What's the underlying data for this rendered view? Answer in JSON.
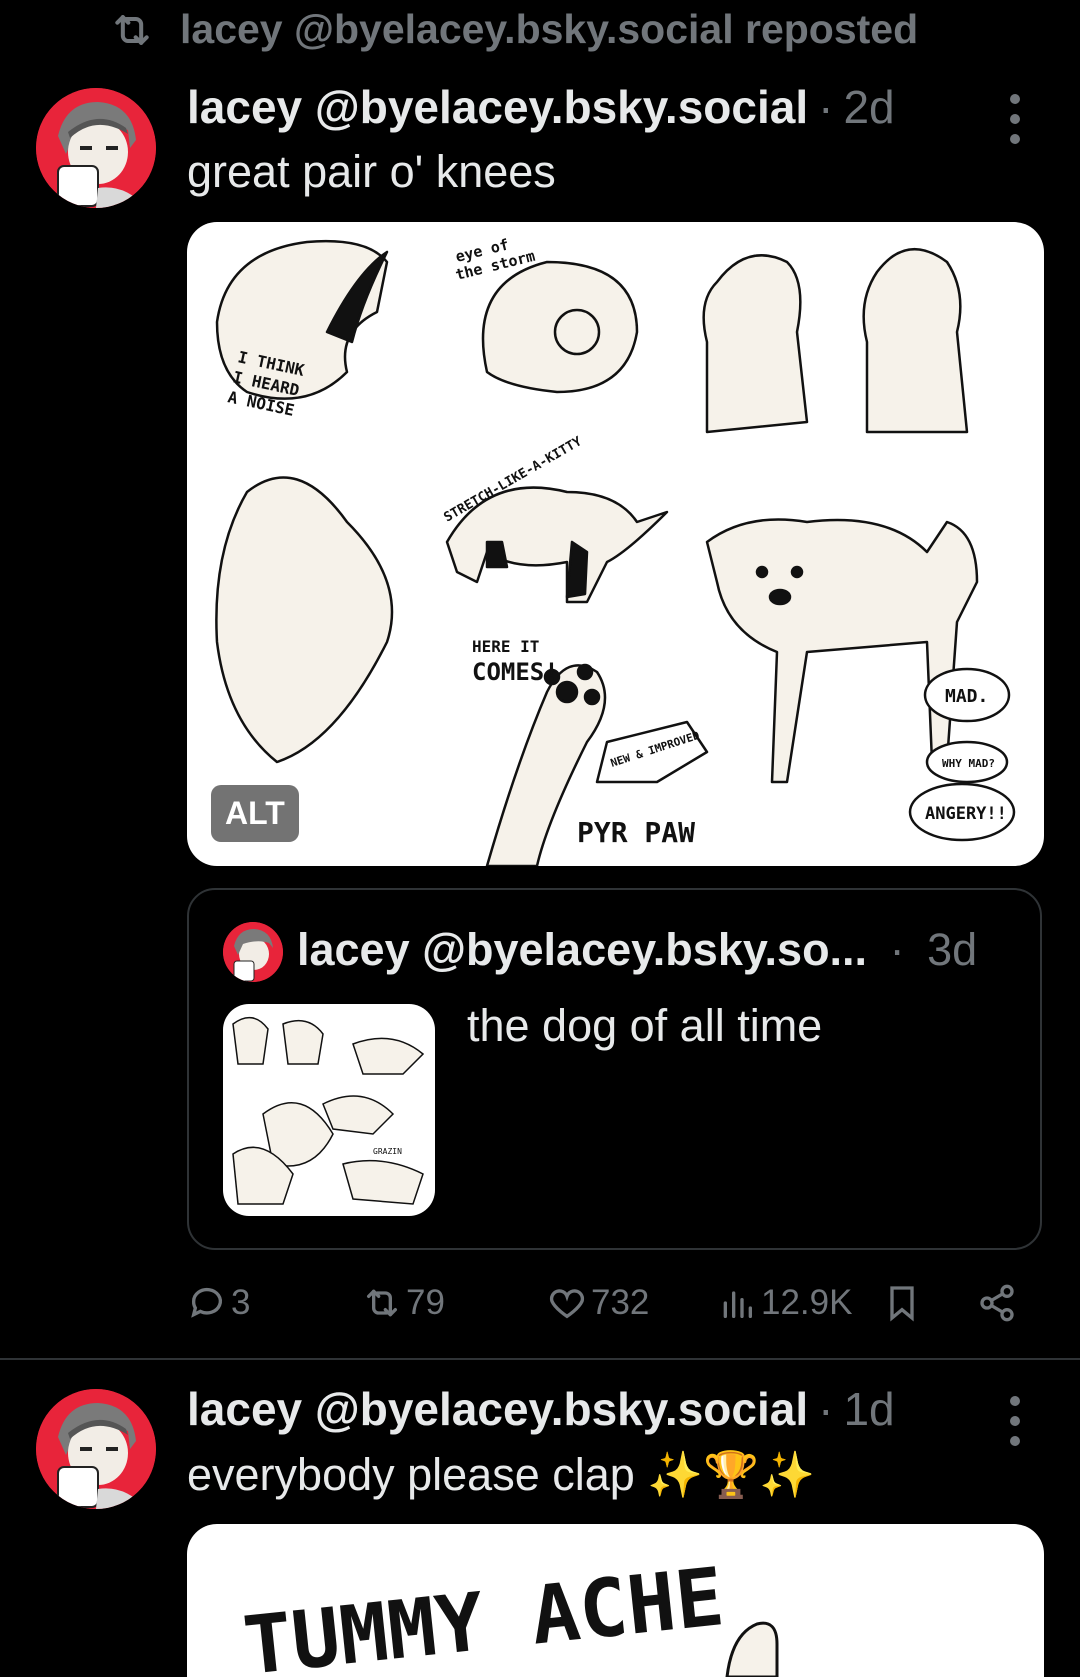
{
  "repost": {
    "text": "lacey @byelacey.bsky.social reposted",
    "icon": "repost-icon"
  },
  "post1": {
    "name": "lacey @byelacey.bsky.social",
    "separator": "·",
    "time": "2d",
    "text": "great pair o' knees",
    "media_alt_badge": "ALT",
    "media_texts": {
      "noise": "I THINK I HEARD A NOISE",
      "storm": "eye of the storm",
      "stretch": "STRETCH-LIKE-A-KITTY",
      "here": "HERE IT",
      "comes": "COMES!",
      "new": "NEW & IMPROVED",
      "pyr": "PYR PAW",
      "mad": "MAD.",
      "why": "WHY MAD?",
      "angery": "ANGERY!!"
    },
    "quote": {
      "name": "lacey @byelacey.bsky.so...",
      "separator": "·",
      "time": "3d",
      "text": "the dog of all time",
      "thumb_text": "GRAZIN"
    },
    "actions": {
      "replies": "3",
      "reposts": "79",
      "likes": "732",
      "views": "12.9K"
    }
  },
  "post2": {
    "name": "lacey @byelacey.bsky.social",
    "separator": "·",
    "time": "1d",
    "text": "everybody please clap ✨🏆✨",
    "media_text": "TUMMY ACHE"
  },
  "colors": {
    "background": "#000000",
    "text": "#e7e9ea",
    "muted": "#71767b",
    "avatar_accent": "#e8243a",
    "border": "#2f3336"
  }
}
